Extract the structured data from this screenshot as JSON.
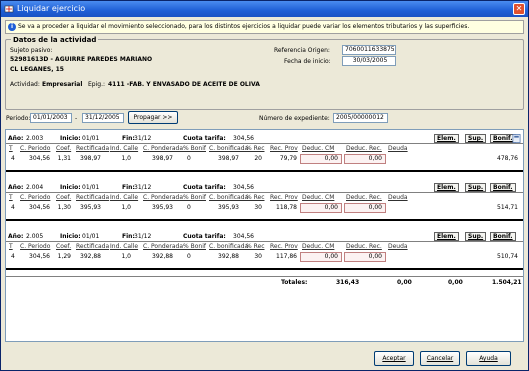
{
  "window": {
    "title": "Liquidar ejercicio",
    "close_label": "✕"
  },
  "info": {
    "icon": "info-icon",
    "text": "Se va a proceder a liquidar el movimiento seleccionado, para los distintos ejercicios a liquidar puede variar los elementos tributarios y las superficies."
  },
  "activity": {
    "legend": "Datos de la actividad",
    "sujeto_label": "Sujeto pasivo:",
    "sujeto_name": "52981613D - AGUIRRE PAREDES MARIANO",
    "city": "CL LEGANES, 15",
    "ref_label": "Referencia Origen:",
    "ref_value": "7060011633875",
    "fecha_label": "Fecha de inicio:",
    "fecha_value": "30/03/2005",
    "actividad_label": "Actividad:",
    "actividad_value": "Empresarial",
    "epig_label": "Epig.:",
    "epig_value": "4111 -FAB. Y ENVASADO DE ACEITE DE OLIVA"
  },
  "periodo": {
    "label": "Periodo:",
    "from": "01/01/2003",
    "sep": "-",
    "to": "31/12/2005",
    "button": "Propagar >>",
    "exp_label": "Número de expediente:",
    "exp_value": "2005/00000012"
  },
  "columns": [
    "T",
    "C. Periodo",
    "Coef.",
    "Rectificada",
    "Ind. Calle",
    "C. Ponderada",
    "% Bonif",
    "C. bonificada",
    "% Rec",
    "Rec. Prov",
    "Deduc. CM",
    "Deduc. Rec.",
    "Deuda"
  ],
  "labels": {
    "anio": "Año:",
    "inicio": "Inicio:",
    "fin": "Fin:",
    "cuota": "Cuota tarifa:",
    "elem": "Elem.",
    "sup": "Sup.",
    "bonif": "Bonif."
  },
  "years": [
    {
      "anio": "2.003",
      "inicio": "01/01",
      "fin": "31/12",
      "cuota": "304,56",
      "row": [
        "4",
        "304,56",
        "1,31",
        "398,97",
        "1,0",
        "398,97",
        "0",
        "398,97",
        "20",
        "79,79",
        "0,00",
        "0,00",
        "478,76"
      ]
    },
    {
      "anio": "2.004",
      "inicio": "01/01",
      "fin": "31/12",
      "cuota": "304,56",
      "row": [
        "4",
        "304,56",
        "1,30",
        "395,93",
        "1,0",
        "395,93",
        "0",
        "395,93",
        "30",
        "118,78",
        "0,00",
        "0,00",
        "514,71"
      ]
    },
    {
      "anio": "2.005",
      "inicio": "01/01",
      "fin": "31/12",
      "cuota": "304,56",
      "row": [
        "4",
        "304,56",
        "1,29",
        "392,88",
        "1,0",
        "392,88",
        "0",
        "392,88",
        "30",
        "117,86",
        "0,00",
        "0,00",
        "510,74"
      ]
    }
  ],
  "totals": {
    "label": "Totales:",
    "rec_prov": "316,43",
    "deduc_cm": "0,00",
    "deduc_rec": "0,00",
    "deuda": "1.504,21"
  },
  "buttons": {
    "aceptar": "Aceptar",
    "cancelar": "Cancelar",
    "ayuda": "Ayuda"
  }
}
